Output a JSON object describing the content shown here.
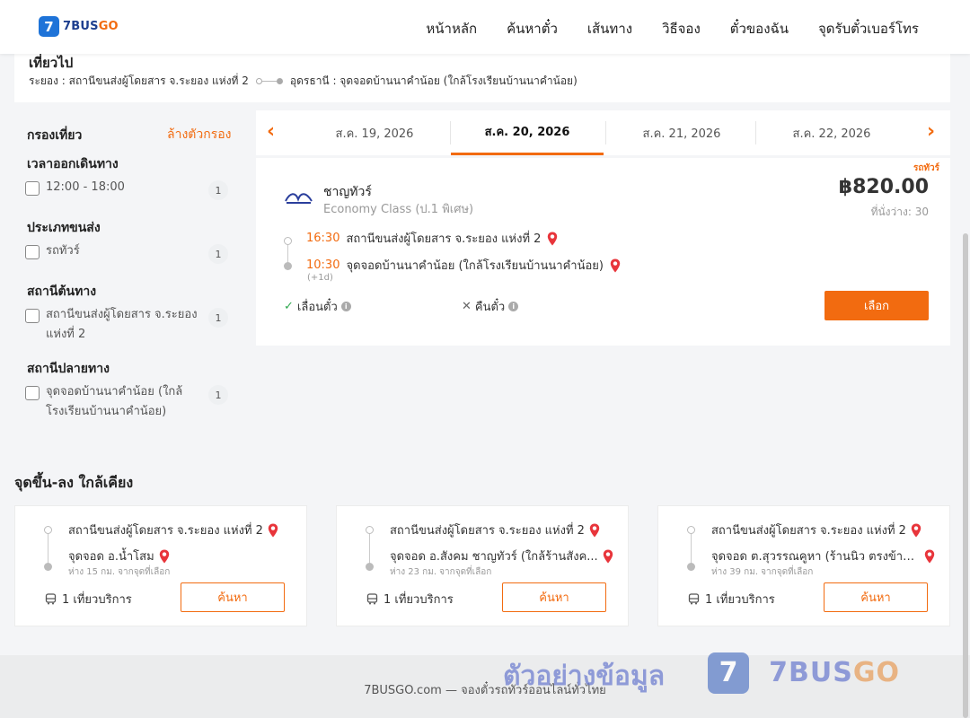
{
  "brand": {
    "badge": "7",
    "name_part1": "7BUS",
    "name_part2": "GO"
  },
  "nav": [
    "หน้าหลัก",
    "ค้นหาตั๋ว",
    "เส้นทาง",
    "วิธีจอง",
    "ตั๋วของฉัน",
    "จุดรับตั๋วเบอร์โทร"
  ],
  "trip": {
    "title": "เที่ยวไป",
    "from": "ระยอง : สถานีขนส่งผู้โดยสาร จ.ระยอง แห่งที่ 2",
    "to": "อุดรธานี : จุดจอดบ้านนาคำน้อย (ใกล้โรงเรียนบ้านนาคำน้อย)"
  },
  "filters": {
    "title": "กรองเที่ยว",
    "clear": "ล้างตัวกรอง",
    "sections": [
      {
        "title": "เวลาออกเดินทาง",
        "item": "12:00 - 18:00",
        "count": "1"
      },
      {
        "title": "ประเภทขนส่ง",
        "item": "รถทัวร์",
        "count": "1"
      },
      {
        "title": "สถานีต้นทาง",
        "item": "สถานีขนส่งผู้โดยสาร จ.ระยอง แห่งที่ 2",
        "count": "1"
      },
      {
        "title": "สถานีปลายทาง",
        "item": "จุดจอดบ้านนาคำน้อย (ใกล้โรงเรียนบ้านนาคำน้อย)",
        "count": "1"
      }
    ]
  },
  "dates": {
    "tabs": [
      "ส.ค. 19, 2026",
      "ส.ค. 20, 2026",
      "ส.ค. 21, 2026",
      "ส.ค. 22, 2026"
    ],
    "active_index": 1,
    "prev_icon": "‹",
    "next_icon": "›"
  },
  "trip_card": {
    "tag": "รถทัวร์",
    "operator": "ชาญทัวร์",
    "class": "Economy Class (ป.1 พิเศษ)",
    "price": "฿820.00",
    "seats": "ที่นั่งว่าง: 30",
    "depart_time": "16:30",
    "depart_station": "สถานีขนส่งผู้โดยสาร จ.ระยอง แห่งที่ 2",
    "arrive_time": "10:30",
    "arrive_station": "จุดจอดบ้านนาคำน้อย (ใกล้โรงเรียนบ้านนาคำน้อย)",
    "plus_day": "(+1d)",
    "reschedule": "เลื่อนตั๋ว",
    "refund": "คืนตั๋ว",
    "select": "เลือก",
    "accent": "#f26b10"
  },
  "nearby": {
    "title": "จุดขึ้น-ลง ใกล้เคียง",
    "cards": [
      {
        "from": "สถานีขนส่งผู้โดยสาร จ.ระยอง แห่งที่ 2",
        "to": "จุดจอด อ.น้ำโสม",
        "distance": "ห่าง 15 กม. จากจุดที่เลือก",
        "trips": "1 เที่ยวบริการ",
        "button": "ค้นหา"
      },
      {
        "from": "สถานีขนส่งผู้โดยสาร จ.ระยอง แห่งที่ 2",
        "to": "จุดจอด อ.สังคม ชาญทัวร์ (ใกล้ร้านสังค...",
        "distance": "ห่าง 23 กม. จากจุดที่เลือก",
        "trips": "1 เที่ยวบริการ",
        "button": "ค้นหา"
      },
      {
        "from": "สถานีขนส่งผู้โดยสาร จ.ระยอง แห่งที่ 2",
        "to": "จุดจอด ต.สุวรรณคูหา (ร้านนิว ตรงข้ามเ...",
        "distance": "ห่าง 39 กม. จากจุดที่เลือก",
        "trips": "1 เที่ยวบริการ",
        "button": "ค้นหา"
      }
    ]
  },
  "footer": {
    "text": "7BUSGO.com — จองตั๋วรถทัวร์ออนไลน์ทั่วไทย"
  },
  "watermark": {
    "text": "ตัวอย่างข้อมูล",
    "badge": "7",
    "brand_a": "7BUS",
    "brand_b": "GO"
  }
}
